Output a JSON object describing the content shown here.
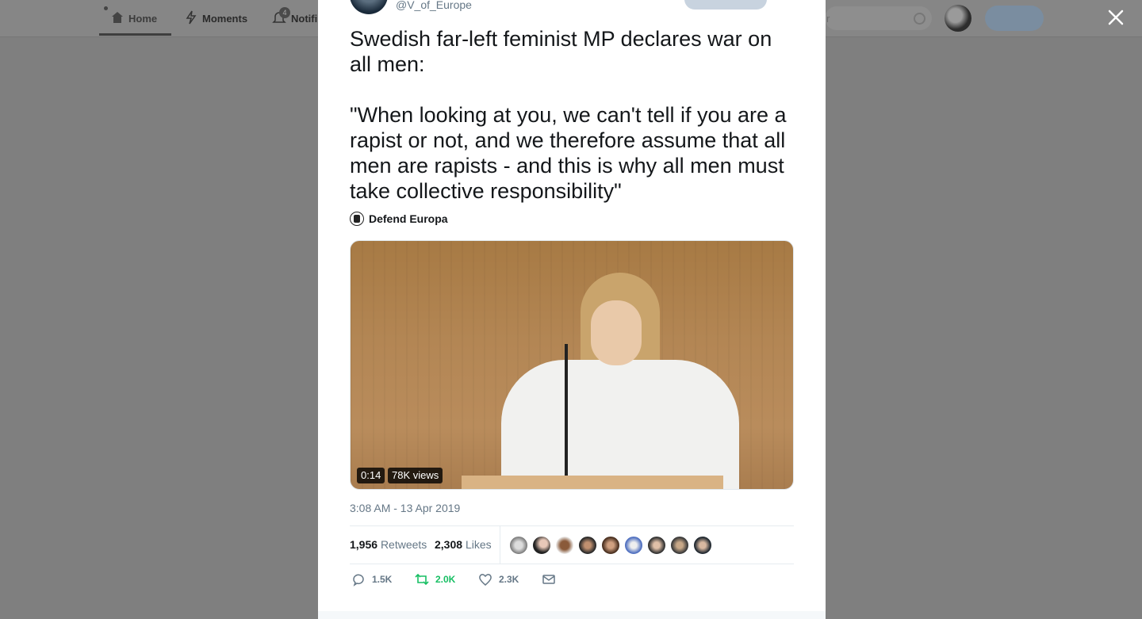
{
  "nav": {
    "home_label": "Home",
    "moments_label": "Moments",
    "notifications_label": "Notifi",
    "notifications_count": "4",
    "search_placeholder": "r"
  },
  "tweet": {
    "handle": "@V_of_Europe",
    "text": "Swedish far-left feminist MP declares war on all men:\n\n\"When looking at you, we can't tell if you are a rapist or not, and we therefore assume that all men are rapists - and this is why all men must take collective responsibility\"",
    "source_name": "Defend Europa",
    "video_duration": "0:14",
    "video_views": "78K views",
    "timestamp": "3:08 AM - 13 Apr 2019",
    "retweets_count": "1,956",
    "retweets_label": "Retweets",
    "likes_count": "2,308",
    "likes_label": "Likes",
    "reply_action_count": "1.5K",
    "retweet_action_count": "2.0K",
    "like_action_count": "2.3K"
  },
  "colors": {
    "retweet_green": "#17bf63",
    "secondary_text": "#657786"
  }
}
